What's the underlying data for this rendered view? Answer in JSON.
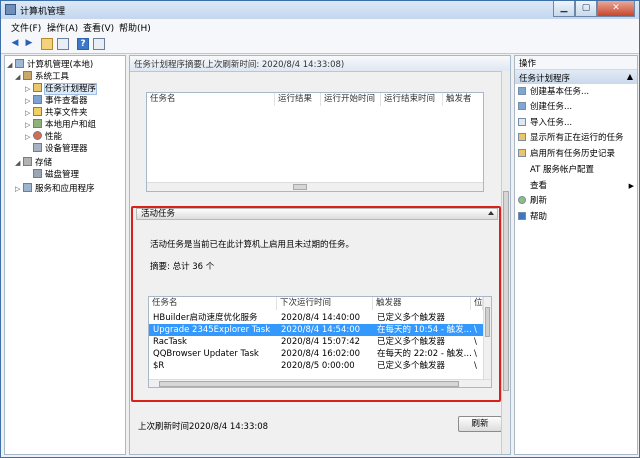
{
  "window": {
    "title": "计算机管理"
  },
  "menu": [
    "文件(F)",
    "操作(A)",
    "查看(V)",
    "帮助(H)"
  ],
  "tree": [
    {
      "label": "计算机管理(本地)",
      "level": 0,
      "exp": "◢"
    },
    {
      "label": "系统工具",
      "level": 1,
      "exp": "◢"
    },
    {
      "label": "任务计划程序",
      "level": 2,
      "exp": "▷",
      "selected": true
    },
    {
      "label": "事件查看器",
      "level": 2,
      "exp": "▷"
    },
    {
      "label": "共享文件夹",
      "level": 2,
      "exp": "▷"
    },
    {
      "label": "本地用户和组",
      "level": 2,
      "exp": "▷"
    },
    {
      "label": "性能",
      "level": 2,
      "exp": "▷"
    },
    {
      "label": "设备管理器",
      "level": 2,
      "exp": ""
    },
    {
      "label": "存储",
      "level": 1,
      "exp": "◢"
    },
    {
      "label": "磁盘管理",
      "level": 2,
      "exp": ""
    },
    {
      "label": "服务和应用程序",
      "level": 1,
      "exp": "▷"
    }
  ],
  "center": {
    "header": "任务计划程序摘要(上次刷新时间: 2020/8/4 14:33:08)",
    "top_columns": [
      "任务名",
      "运行结果",
      "运行开始时间",
      "运行结束时间",
      "触发者"
    ],
    "section_title": "活动任务",
    "description": "活动任务是当前已在此计算机上启用且未过期的任务。",
    "summary": "摘要: 总计 36 个",
    "columns": [
      "任务名",
      "下次运行时间",
      "触发器",
      "位"
    ],
    "rows": [
      [
        "HBuilder启动速度优化服务",
        "2020/8/4 14:40:00",
        "已定义多个触发器",
        ""
      ],
      [
        "Upgrade 2345Explorer Task",
        "2020/8/4 14:54:00",
        "在每天的 10:54 - 触发...",
        "\\"
      ],
      [
        "RacTask",
        "2020/8/4 15:07:42",
        "已定义多个触发器",
        "\\"
      ],
      [
        "QQBrowser Updater Task",
        "2020/8/4 16:02:00",
        "在每天的 22:02 - 触发...",
        "\\"
      ],
      [
        "$R",
        "2020/8/5 0:00:00",
        "已定义多个触发器",
        "\\"
      ]
    ],
    "selected_row": 1,
    "last_refresh": "上次刷新时间2020/8/4 14:33:08",
    "refresh_button": "刷新"
  },
  "actions": {
    "header": "操作",
    "subheader": "任务计划程序",
    "items": [
      {
        "label": "创建基本任务...",
        "icon": "create-basic-task-icon"
      },
      {
        "label": "创建任务...",
        "icon": "create-task-icon"
      },
      {
        "label": "导入任务...",
        "icon": "import-icon"
      },
      {
        "label": "显示所有正在运行的任务",
        "icon": "running-tasks-icon"
      },
      {
        "label": "启用所有任务历史记录",
        "icon": "history-icon"
      },
      {
        "label": "AT 服务帐户配置",
        "icon": ""
      },
      {
        "label": "查看",
        "icon": "",
        "submenu": true
      },
      {
        "label": "刷新",
        "icon": "refresh-icon"
      },
      {
        "label": "帮助",
        "icon": "help-icon"
      }
    ]
  },
  "colors": {
    "selection": "#3399ff",
    "highlight_box": "#d9211c"
  }
}
